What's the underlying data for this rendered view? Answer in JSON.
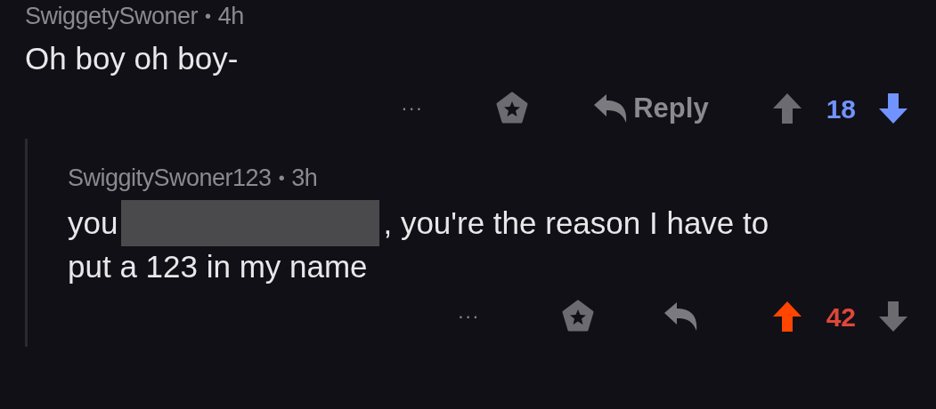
{
  "comments": [
    {
      "author": "SwiggetySwoner",
      "separator": "•",
      "time": "4h",
      "lines": [
        [
          {
            "kind": "text",
            "text": "Oh boy oh boy-"
          }
        ]
      ],
      "more": "···",
      "reply_label": "Reply",
      "upvoted": false,
      "downvoted": true,
      "score": "18"
    },
    {
      "author": "SwiggitySwoner123",
      "separator": "•",
      "time": "3h",
      "lines": [
        [
          {
            "kind": "text",
            "text": "you"
          },
          {
            "kind": "redacted"
          },
          {
            "kind": "text",
            "text": ", you're the reason I have to"
          }
        ],
        [
          {
            "kind": "text",
            "text": "put a 123 in my name"
          }
        ]
      ],
      "more": "···",
      "upvoted": true,
      "downvoted": false,
      "score": "42"
    }
  ]
}
